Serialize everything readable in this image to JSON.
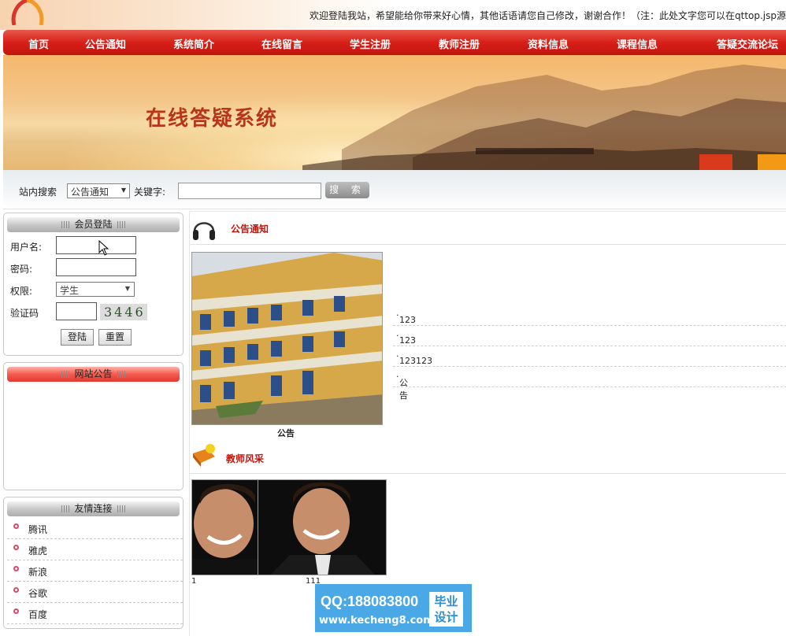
{
  "header": {
    "welcome": "欢迎登陆我站，希望能给你带来好心情，其他话语请您自己修改，谢谢合作！（注：此处文字您可以在qttop.jsp源"
  },
  "nav": [
    "首页",
    "公告通知",
    "系统简介",
    "在线留言",
    "学生注册",
    "教师注册",
    "资料信息",
    "课程信息",
    "答疑交流论坛"
  ],
  "banner": {
    "title": "在线答疑系统"
  },
  "search": {
    "label": "站内搜索",
    "select_value": "公告通知",
    "keyword_label": "关键字:",
    "button": "搜 索"
  },
  "login": {
    "title": "会员登陆",
    "username_label": "用户名:",
    "password_label": "密码:",
    "role_label": "权限:",
    "role_value": "学生",
    "captcha_label": "验证码",
    "captcha_code": "3446",
    "login_button": "登陆",
    "reset_button": "重置"
  },
  "site_notice": {
    "title": "网站公告"
  },
  "links": {
    "title": "友情连接",
    "items": [
      "腾讯",
      "雅虎",
      "新浪",
      "谷歌",
      "百度"
    ]
  },
  "announcements": {
    "title": "公告通知",
    "photo_caption": "公告",
    "items": [
      "123",
      "123",
      "123123",
      "公告"
    ]
  },
  "teachers": {
    "title": "教师风采",
    "items": [
      {
        "caption": "1"
      },
      {
        "caption": "111"
      }
    ]
  },
  "badge": {
    "qq": "QQ:188083800",
    "url": "www.kecheng8.com",
    "tag_line1": "毕业",
    "tag_line2": "设计"
  }
}
